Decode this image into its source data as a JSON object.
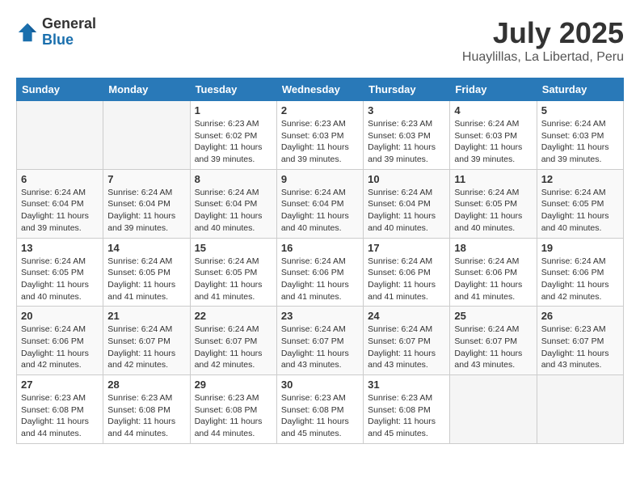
{
  "header": {
    "logo_general": "General",
    "logo_blue": "Blue",
    "month_year": "July 2025",
    "location": "Huaylillas, La Libertad, Peru"
  },
  "calendar": {
    "days_of_week": [
      "Sunday",
      "Monday",
      "Tuesday",
      "Wednesday",
      "Thursday",
      "Friday",
      "Saturday"
    ],
    "weeks": [
      [
        {
          "day": "",
          "content": ""
        },
        {
          "day": "",
          "content": ""
        },
        {
          "day": "1",
          "content": "Sunrise: 6:23 AM\nSunset: 6:02 PM\nDaylight: 11 hours and 39 minutes."
        },
        {
          "day": "2",
          "content": "Sunrise: 6:23 AM\nSunset: 6:03 PM\nDaylight: 11 hours and 39 minutes."
        },
        {
          "day": "3",
          "content": "Sunrise: 6:23 AM\nSunset: 6:03 PM\nDaylight: 11 hours and 39 minutes."
        },
        {
          "day": "4",
          "content": "Sunrise: 6:24 AM\nSunset: 6:03 PM\nDaylight: 11 hours and 39 minutes."
        },
        {
          "day": "5",
          "content": "Sunrise: 6:24 AM\nSunset: 6:03 PM\nDaylight: 11 hours and 39 minutes."
        }
      ],
      [
        {
          "day": "6",
          "content": "Sunrise: 6:24 AM\nSunset: 6:04 PM\nDaylight: 11 hours and 39 minutes."
        },
        {
          "day": "7",
          "content": "Sunrise: 6:24 AM\nSunset: 6:04 PM\nDaylight: 11 hours and 39 minutes."
        },
        {
          "day": "8",
          "content": "Sunrise: 6:24 AM\nSunset: 6:04 PM\nDaylight: 11 hours and 40 minutes."
        },
        {
          "day": "9",
          "content": "Sunrise: 6:24 AM\nSunset: 6:04 PM\nDaylight: 11 hours and 40 minutes."
        },
        {
          "day": "10",
          "content": "Sunrise: 6:24 AM\nSunset: 6:04 PM\nDaylight: 11 hours and 40 minutes."
        },
        {
          "day": "11",
          "content": "Sunrise: 6:24 AM\nSunset: 6:05 PM\nDaylight: 11 hours and 40 minutes."
        },
        {
          "day": "12",
          "content": "Sunrise: 6:24 AM\nSunset: 6:05 PM\nDaylight: 11 hours and 40 minutes."
        }
      ],
      [
        {
          "day": "13",
          "content": "Sunrise: 6:24 AM\nSunset: 6:05 PM\nDaylight: 11 hours and 40 minutes."
        },
        {
          "day": "14",
          "content": "Sunrise: 6:24 AM\nSunset: 6:05 PM\nDaylight: 11 hours and 41 minutes."
        },
        {
          "day": "15",
          "content": "Sunrise: 6:24 AM\nSunset: 6:05 PM\nDaylight: 11 hours and 41 minutes."
        },
        {
          "day": "16",
          "content": "Sunrise: 6:24 AM\nSunset: 6:06 PM\nDaylight: 11 hours and 41 minutes."
        },
        {
          "day": "17",
          "content": "Sunrise: 6:24 AM\nSunset: 6:06 PM\nDaylight: 11 hours and 41 minutes."
        },
        {
          "day": "18",
          "content": "Sunrise: 6:24 AM\nSunset: 6:06 PM\nDaylight: 11 hours and 41 minutes."
        },
        {
          "day": "19",
          "content": "Sunrise: 6:24 AM\nSunset: 6:06 PM\nDaylight: 11 hours and 42 minutes."
        }
      ],
      [
        {
          "day": "20",
          "content": "Sunrise: 6:24 AM\nSunset: 6:06 PM\nDaylight: 11 hours and 42 minutes."
        },
        {
          "day": "21",
          "content": "Sunrise: 6:24 AM\nSunset: 6:07 PM\nDaylight: 11 hours and 42 minutes."
        },
        {
          "day": "22",
          "content": "Sunrise: 6:24 AM\nSunset: 6:07 PM\nDaylight: 11 hours and 42 minutes."
        },
        {
          "day": "23",
          "content": "Sunrise: 6:24 AM\nSunset: 6:07 PM\nDaylight: 11 hours and 43 minutes."
        },
        {
          "day": "24",
          "content": "Sunrise: 6:24 AM\nSunset: 6:07 PM\nDaylight: 11 hours and 43 minutes."
        },
        {
          "day": "25",
          "content": "Sunrise: 6:24 AM\nSunset: 6:07 PM\nDaylight: 11 hours and 43 minutes."
        },
        {
          "day": "26",
          "content": "Sunrise: 6:23 AM\nSunset: 6:07 PM\nDaylight: 11 hours and 43 minutes."
        }
      ],
      [
        {
          "day": "27",
          "content": "Sunrise: 6:23 AM\nSunset: 6:08 PM\nDaylight: 11 hours and 44 minutes."
        },
        {
          "day": "28",
          "content": "Sunrise: 6:23 AM\nSunset: 6:08 PM\nDaylight: 11 hours and 44 minutes."
        },
        {
          "day": "29",
          "content": "Sunrise: 6:23 AM\nSunset: 6:08 PM\nDaylight: 11 hours and 44 minutes."
        },
        {
          "day": "30",
          "content": "Sunrise: 6:23 AM\nSunset: 6:08 PM\nDaylight: 11 hours and 45 minutes."
        },
        {
          "day": "31",
          "content": "Sunrise: 6:23 AM\nSunset: 6:08 PM\nDaylight: 11 hours and 45 minutes."
        },
        {
          "day": "",
          "content": ""
        },
        {
          "day": "",
          "content": ""
        }
      ]
    ]
  }
}
